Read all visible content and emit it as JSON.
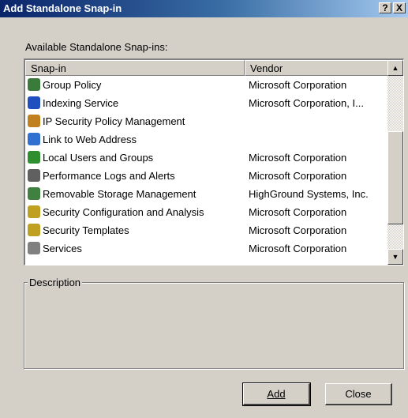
{
  "window": {
    "title": "Add Standalone Snap-in",
    "help_label": "?",
    "close_label": "X"
  },
  "available_label": "Available Standalone Snap-ins:",
  "list": {
    "columns": [
      "Snap-in",
      "Vendor"
    ],
    "rows": [
      {
        "name": "Group Policy",
        "vendor": "Microsoft Corporation",
        "icon": "group-policy-icon",
        "color": "#3a7a3a"
      },
      {
        "name": "Indexing Service",
        "vendor": "Microsoft Corporation, I...",
        "icon": "indexing-service-icon",
        "color": "#2050c0"
      },
      {
        "name": "IP Security Policy Management",
        "vendor": "",
        "icon": "ip-security-icon",
        "color": "#c08020"
      },
      {
        "name": "Link to Web Address",
        "vendor": "",
        "icon": "web-link-icon",
        "color": "#3070d0"
      },
      {
        "name": "Local Users and Groups",
        "vendor": "Microsoft Corporation",
        "icon": "users-groups-icon",
        "color": "#2f8f2f"
      },
      {
        "name": "Performance Logs and Alerts",
        "vendor": "Microsoft Corporation",
        "icon": "performance-icon",
        "color": "#606060"
      },
      {
        "name": "Removable Storage Management",
        "vendor": "HighGround Systems, Inc.",
        "icon": "removable-storage-icon",
        "color": "#408040"
      },
      {
        "name": "Security Configuration and Analysis",
        "vendor": "Microsoft Corporation",
        "icon": "security-config-icon",
        "color": "#c0a020"
      },
      {
        "name": "Security Templates",
        "vendor": "Microsoft Corporation",
        "icon": "security-templates-icon",
        "color": "#c0a020"
      },
      {
        "name": "Services",
        "vendor": "Microsoft Corporation",
        "icon": "services-gears-icon",
        "color": "#808080"
      }
    ]
  },
  "description_label": "Description",
  "buttons": {
    "add": "Add",
    "close": "Close"
  },
  "scroll": {
    "up_glyph": "▲",
    "down_glyph": "▼"
  }
}
